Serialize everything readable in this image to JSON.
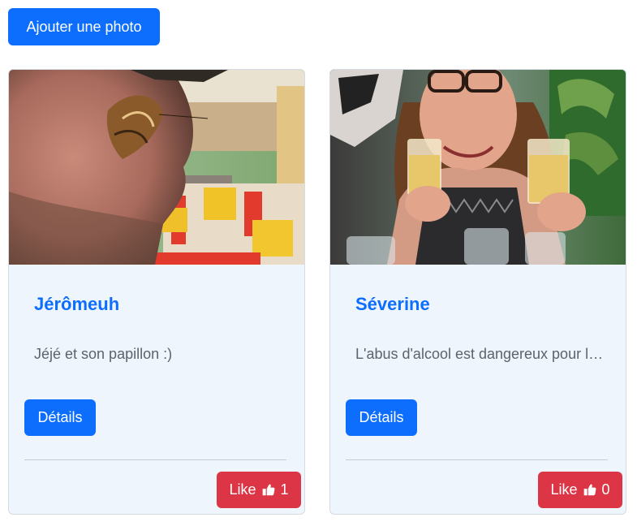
{
  "toolbar": {
    "add_photo_label": "Ajouter une photo"
  },
  "cards": [
    {
      "title": "Jérômeuh",
      "description": "Jéjé et son papillon :)",
      "details_label": "Détails",
      "like_label": "Like",
      "like_count": "1",
      "like_icon": "thumbs-up-icon",
      "photo": "man-with-butterfly-on-nose"
    },
    {
      "title": "Séverine",
      "description": "L'abus d'alcool est dangereux pour la santé",
      "details_label": "Détails",
      "like_label": "Like",
      "like_count": "0",
      "like_icon": "thumbs-up-icon",
      "photo": "woman-holding-champagne-glasses"
    }
  ],
  "colors": {
    "primary": "#0d6efd",
    "danger": "#dc3545",
    "card_background": "#eef5fd",
    "title_text": "#0d6efd",
    "body_text": "#5c636a"
  }
}
